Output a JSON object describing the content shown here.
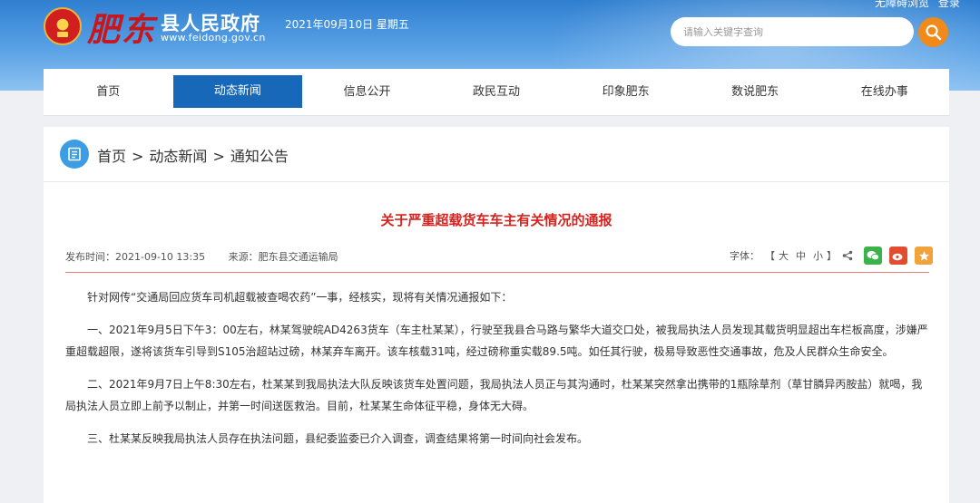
{
  "header": {
    "logo_calligraphy": "肥东",
    "site_title": "县人民政府",
    "site_url": "www.feidong.gov.cn",
    "date": "2021年09月10日 星期五",
    "toplinks": [
      "无障碍浏览",
      "登录"
    ],
    "search_placeholder": "请输入关键字查询",
    "search_icon": "search-icon"
  },
  "nav": {
    "items": [
      "首页",
      "动态新闻",
      "信息公开",
      "政民互动",
      "印象肥东",
      "数说肥东",
      "在线办事"
    ],
    "active_index": 1
  },
  "breadcrumb": {
    "items": [
      "首页",
      "动态新闻",
      "通知公告"
    ],
    "separator": ">"
  },
  "article": {
    "title": "关于严重超载货车车主有关情况的通报",
    "publish_label": "发布时间：",
    "publish_time": "2021-09-10 13:35",
    "source_label": "来源：",
    "source": "肥东县交通运输局",
    "font_label": "字体：",
    "bracket_open": "【",
    "font_sizes": [
      "大",
      "中",
      "小"
    ],
    "bracket_close": "】",
    "paragraphs": [
      "针对网传“交通局回应货车司机超载被查喝农药”一事，经核实，现将有关情况通报如下：",
      "一、2021年9月5日下午3：00左右，林某驾驶皖AD4263货车（车主杜某某），行驶至我县合马路与繁华大道交口处，被我局执法人员发现其载货明显超出车栏板高度，涉嫌严重超载超限，遂将该货车引导到S105治超站过磅，林某弃车离开。该车核载31吨，经过磅称重实载89.5吨。如任其行驶，极易导致恶性交通事故，危及人民群众生命安全。",
      "二、2021年9月7日上午8:30左右，杜某某到我局执法大队反映该货车处置问题，我局执法人员正与其沟通时，杜某某突然拿出携带的1瓶除草剂（草甘膦异丙胺盐）就喝，我局执法人员立即上前予以制止，并第一时间送医救治。目前，杜某某生命体征平稳，身体无大碍。",
      "三、杜某某反映我局执法人员存在执法问题，县纪委监委已介入调查，调查结果将第一时间向社会发布。"
    ]
  },
  "colors": {
    "banner": "#2f7fd0",
    "nav_active": "#1768b8",
    "title_red": "#d7231f",
    "search_orange": "#f08a1a"
  }
}
